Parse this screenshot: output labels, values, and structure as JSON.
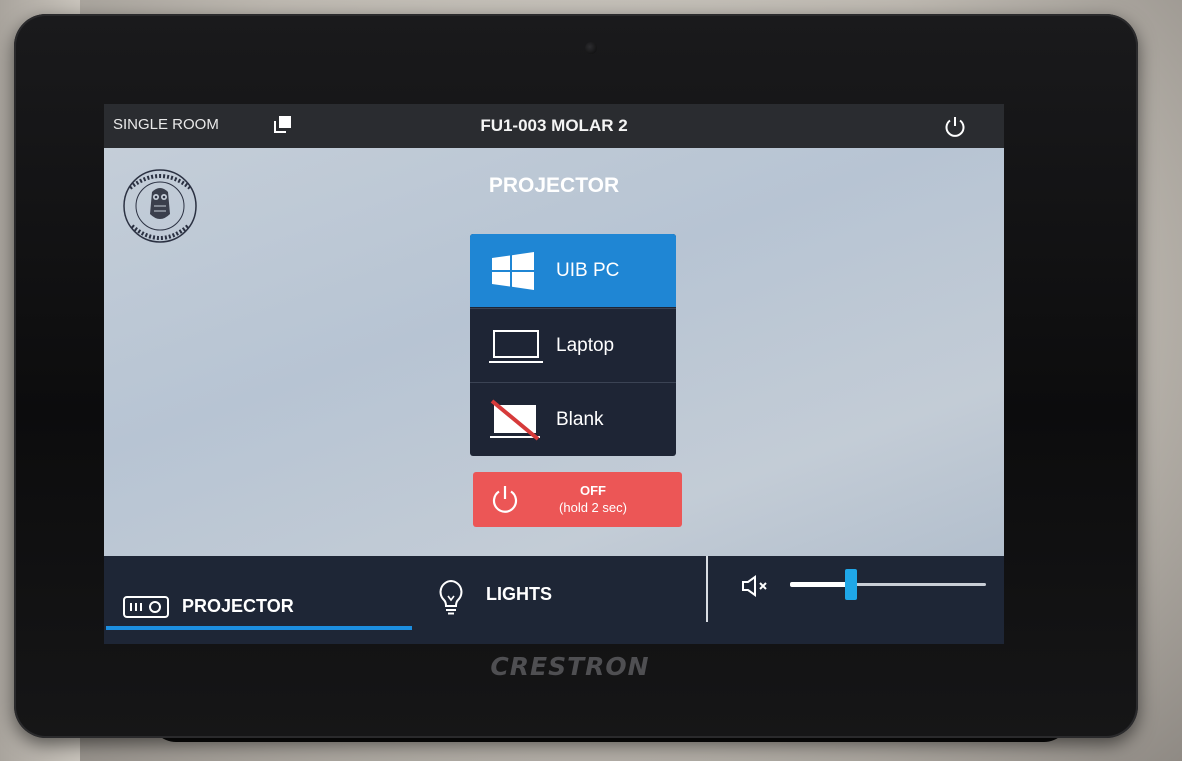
{
  "device": {
    "brand": "CRESTRON"
  },
  "topbar": {
    "room_mode": "SINGLE ROOM",
    "room_name": "FU1-003 MOLAR 2"
  },
  "crest": {
    "text_top": "UNIVERSITAS",
    "text_bottom": "BERGENSIS"
  },
  "main": {
    "section_title": "PROJECTOR",
    "sources": [
      {
        "label": "UIB PC",
        "icon": "windows-icon",
        "active": true
      },
      {
        "label": "Laptop",
        "icon": "laptop-icon",
        "active": false
      },
      {
        "label": "Blank",
        "icon": "blank-screen-icon",
        "active": false
      }
    ],
    "off_button": {
      "line1": "OFF",
      "line2": "(hold 2 sec)"
    }
  },
  "bottombar": {
    "tabs": [
      {
        "label": "PROJECTOR",
        "icon": "projector-icon",
        "active": true
      },
      {
        "label": "LIGHTS",
        "icon": "lightbulb-icon",
        "active": false
      }
    ],
    "volume": {
      "muted": true,
      "level": 0.3
    }
  },
  "colors": {
    "accent_blue": "#1f86d4",
    "off_red": "#ec5656",
    "panel_dark": "#1e2535"
  }
}
